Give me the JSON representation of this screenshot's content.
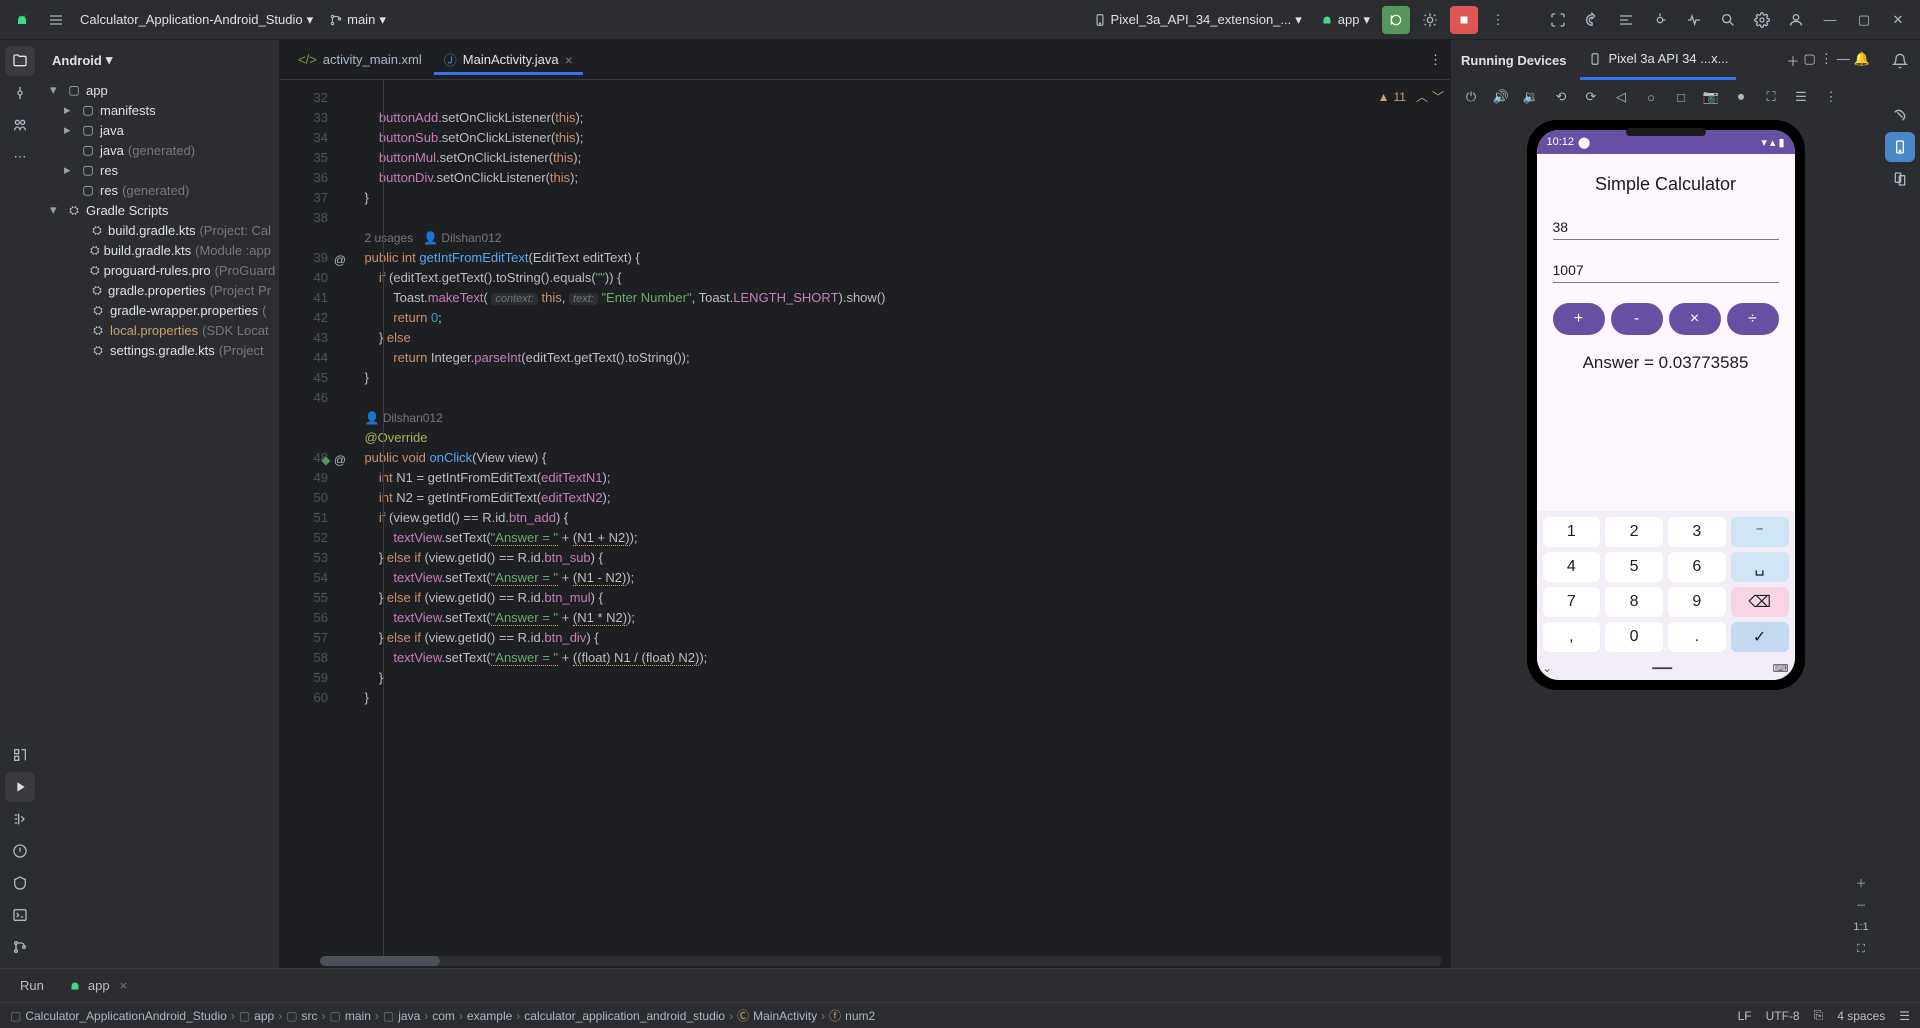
{
  "top": {
    "project": "Calculator_Application-Android_Studio",
    "branch": "main",
    "device_dropdown": "Pixel_3a_API_34_extension_...",
    "run_config": "app"
  },
  "project_panel": {
    "header": "Android",
    "tree": {
      "app": "app",
      "manifests": "manifests",
      "java": "java",
      "java_gen": "java",
      "java_gen_suffix": "(generated)",
      "res": "res",
      "res_gen": "res",
      "res_gen_suffix": "(generated)",
      "gradle_scripts": "Gradle Scripts",
      "bgk1": "build.gradle.kts",
      "bgk1_suffix": "(Project: Cal",
      "bgk2": "build.gradle.kts",
      "bgk2_suffix": "(Module :app",
      "proguard": "proguard-rules.pro",
      "proguard_suffix": "(ProGuard",
      "gprops": "gradle.properties",
      "gprops_suffix": "(Project Pr",
      "gwrap": "gradle-wrapper.properties",
      "gwrap_suffix": "(",
      "local": "local.properties",
      "local_suffix": "(SDK Locat",
      "settings": "settings.gradle.kts",
      "settings_suffix": "(Project"
    }
  },
  "tabs": {
    "xml": "activity_main.xml",
    "java": "MainActivity.java"
  },
  "warnings": "11",
  "gutter": [
    "32",
    "33",
    "34",
    "35",
    "36",
    "37",
    "38",
    "",
    "39",
    "40",
    "41",
    "42",
    "43",
    "44",
    "45",
    "46",
    "",
    "",
    "48",
    "49",
    "50",
    "51",
    "52",
    "53",
    "54",
    "55",
    "56",
    "57",
    "58",
    "59",
    "60"
  ],
  "usage_line": "2 usages",
  "author": "Dilshan012",
  "author2": "Dilshan012",
  "device_panel": {
    "title": "Running Devices",
    "tab": "Pixel 3a API 34 ...x..."
  },
  "emulator": {
    "time": "10:12",
    "app_title": "Simple Calculator",
    "num1": "38",
    "num2": "1007",
    "answer": "Answer = 0.03773585",
    "ops": [
      "+",
      "-",
      "×",
      "÷"
    ],
    "keys": [
      [
        "1",
        "2",
        "3",
        "⁻"
      ],
      [
        "4",
        "5",
        "6",
        "␣"
      ],
      [
        "7",
        "8",
        "9",
        "⌫"
      ],
      [
        ",",
        "0",
        ".",
        "✓"
      ]
    ]
  },
  "run_row": {
    "run": "Run",
    "app": "app"
  },
  "crumbs": [
    "Calculator_ApplicationAndroid_Studio",
    "app",
    "src",
    "main",
    "java",
    "com",
    "example",
    "calculator_application_android_studio",
    "MainActivity",
    "num2"
  ],
  "status": {
    "lf": "LF",
    "enc": "UTF-8",
    "indent": "4 spaces"
  }
}
